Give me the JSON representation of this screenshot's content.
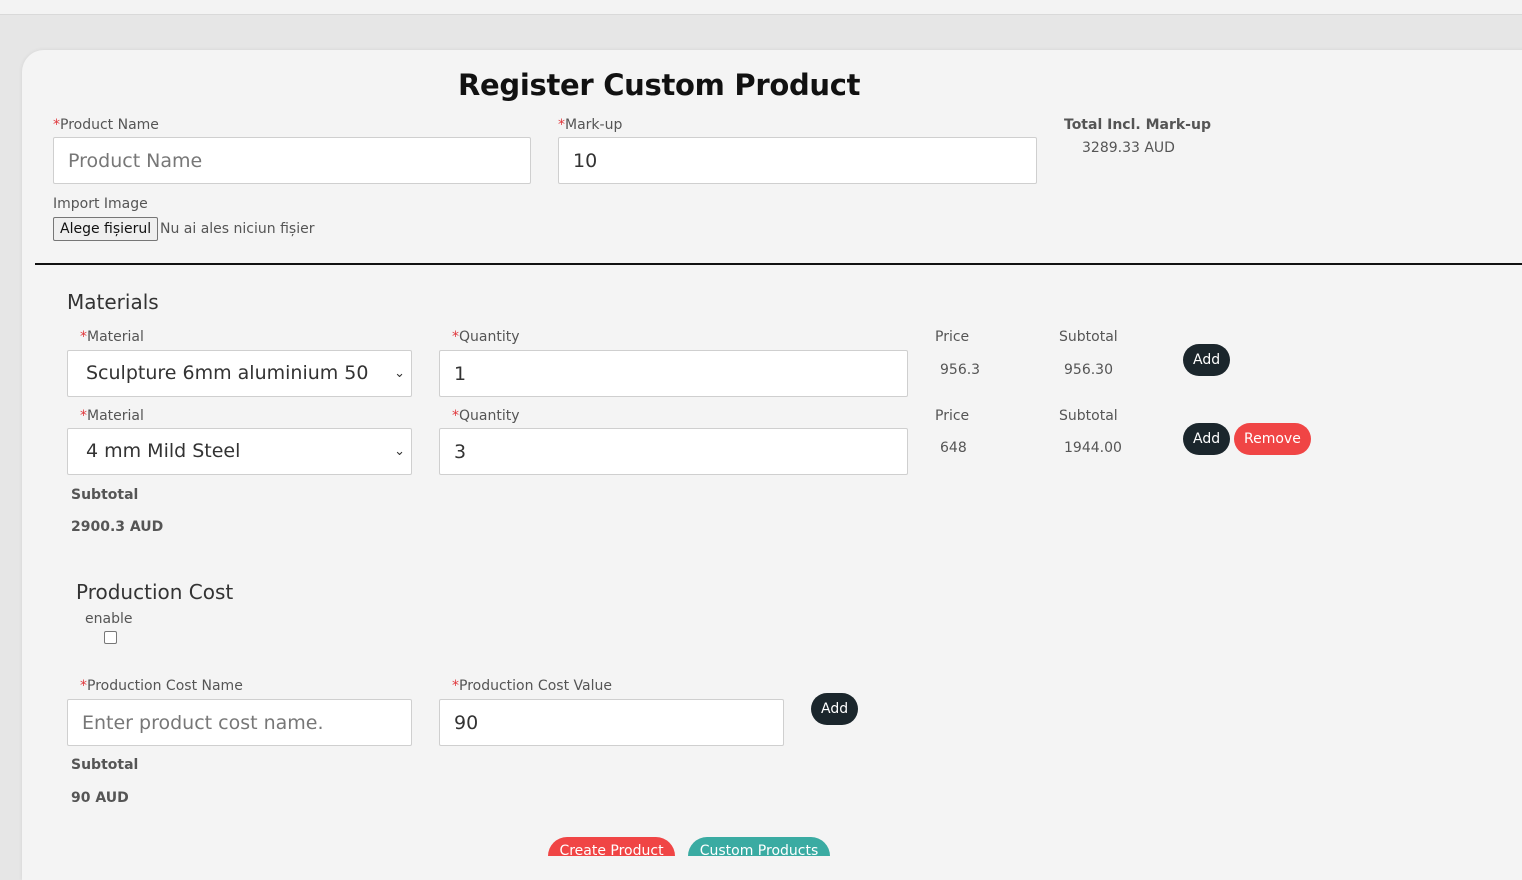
{
  "form": {
    "title": "Register Custom Product",
    "product_name_label": "Product Name",
    "product_name_placeholder": "Product Name",
    "product_name_value": "",
    "markup_label": "Mark-up",
    "markup_value": "10",
    "total_label": "Total Incl. Mark-up",
    "total_value": "3289.33 AUD",
    "import_image_label": "Import Image",
    "file_button_label": "Alege fișierul",
    "file_status": "Nu ai ales niciun fișier",
    "required_marker": "*"
  },
  "materials": {
    "heading": "Materials",
    "rows": [
      {
        "material_label": "Material",
        "material_value": "Sculpture 6mm aluminium 50",
        "quantity_label": "Quantity",
        "quantity_value": "1",
        "price_label": "Price",
        "price_value": "956.3",
        "subtotal_label": "Subtotal",
        "subtotal_value": "956.30",
        "add_label": "Add"
      },
      {
        "material_label": "Material",
        "material_value": "4 mm Mild Steel",
        "quantity_label": "Quantity",
        "quantity_value": "3",
        "price_label": "Price",
        "price_value": "648",
        "subtotal_label": "Subtotal",
        "subtotal_value": "1944.00",
        "add_label": "Add",
        "remove_label": "Remove"
      }
    ],
    "subtotal_label": "Subtotal",
    "subtotal_value": "2900.3 AUD"
  },
  "production": {
    "heading": "Production Cost",
    "enable_label": "enable",
    "enable_checked": false,
    "name_label": "Production Cost Name",
    "name_placeholder": "Enter product cost name.",
    "name_value": "",
    "value_label": "Production Cost Value",
    "value_value": "90",
    "add_label": "Add",
    "subtotal_label": "Subtotal",
    "subtotal_value": "90 AUD"
  },
  "actions": {
    "create_label": "Create Product",
    "custom_products_label": "Custom Products"
  },
  "colors": {
    "accent_red": "#f04545",
    "teal": "#3aaba2",
    "dark": "#1b262c",
    "required": "#e0363b"
  }
}
